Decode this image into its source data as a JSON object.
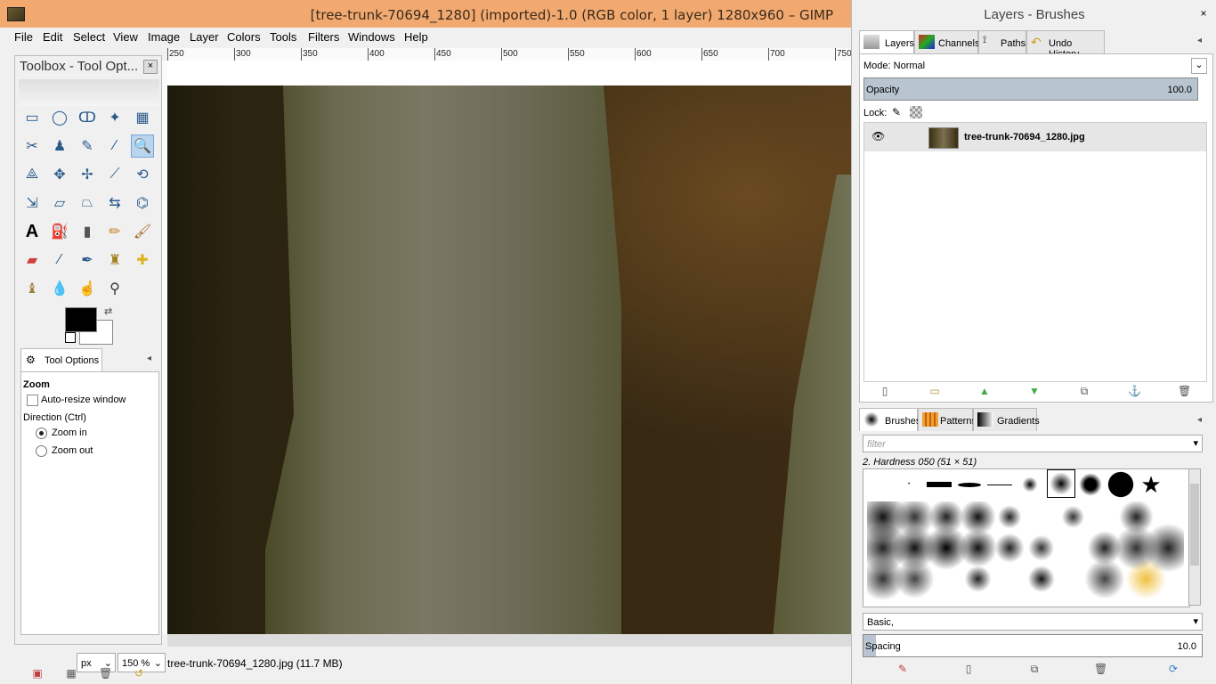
{
  "main": {
    "title": "[tree-trunk-70694_1280] (imported)-1.0 (RGB color, 1 layer) 1280x960 – GIMP",
    "menu": [
      "File",
      "Edit",
      "Select",
      "View",
      "Image",
      "Layer",
      "Colors",
      "Tools",
      "Filters",
      "Windows",
      "Help"
    ],
    "ruler_labels": [
      "250",
      "300",
      "350",
      "400",
      "450",
      "500",
      "550",
      "600",
      "650",
      "700",
      "750"
    ]
  },
  "toolbox": {
    "title": "Toolbox - Tool Opt...",
    "close": "×",
    "tool_options": {
      "tab_label": "Tool Options",
      "heading": "Zoom",
      "auto_resize": "Auto-resize window",
      "direction_label": "Direction  (Ctrl)",
      "zoom_in": "Zoom in",
      "zoom_out": "Zoom out"
    }
  },
  "status": {
    "unit": "px",
    "zoom": "150 %",
    "file_info": "tree-trunk-70694_1280.jpg (11.7 MB)"
  },
  "dock": {
    "title": "Layers - Brushes",
    "close": "×",
    "tabs_top": [
      "Layers",
      "Channels",
      "Paths",
      "Undo History"
    ],
    "layers": {
      "mode_label": "Mode: Normal",
      "opacity_label": "Opacity",
      "opacity_value": "100.0",
      "lock_label": "Lock:",
      "layer_name": "tree-trunk-70694_1280.jpg"
    },
    "tabs_bottom": [
      "Brushes",
      "Patterns",
      "Gradients"
    ],
    "brushes": {
      "filter_placeholder": "filter",
      "current_brush": "2. Hardness 050 (51 × 51)",
      "tag_combo": "Basic,",
      "spacing_label": "Spacing",
      "spacing_value": "10.0"
    }
  }
}
